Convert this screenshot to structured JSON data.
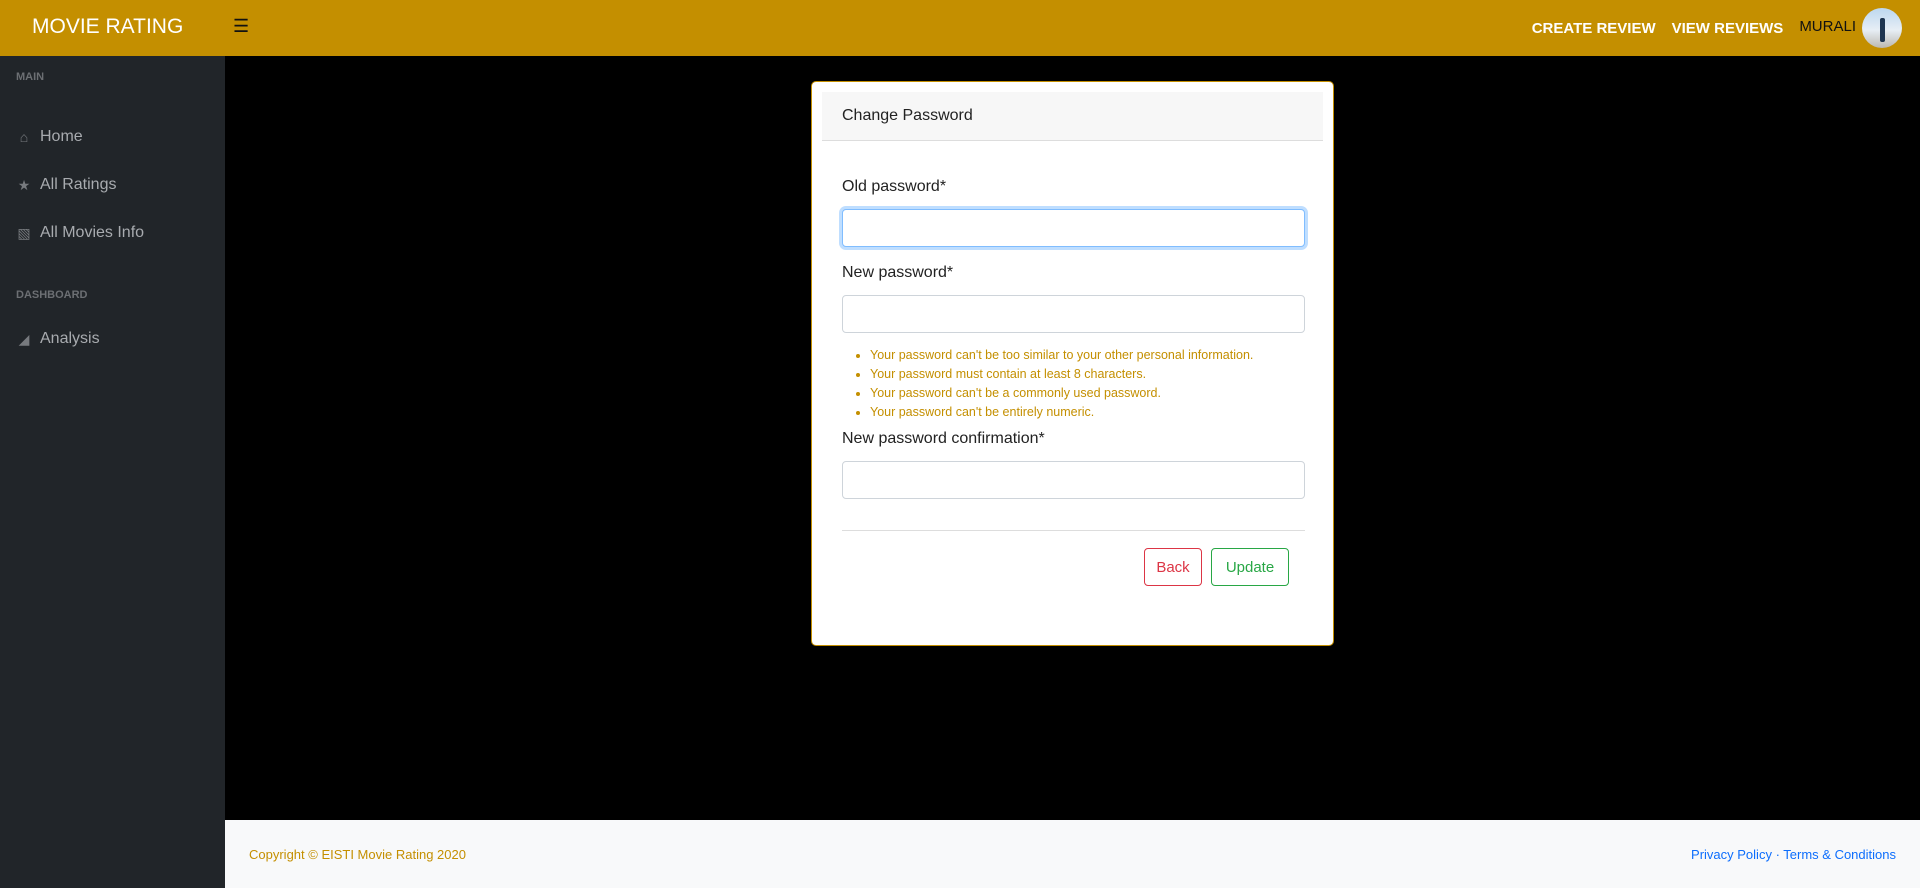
{
  "header": {
    "brand": "MOVIE RATING",
    "menu_icon": "hamburger-icon",
    "nav": [
      "CREATE REVIEW",
      "VIEW REVIEWS"
    ],
    "user": "MURALI"
  },
  "sidebar": {
    "sections": [
      {
        "title": "MAIN",
        "items": [
          {
            "label": "Home",
            "icon": "home-icon"
          },
          {
            "label": "All Ratings",
            "icon": "star-icon"
          },
          {
            "label": "All Movies Info",
            "icon": "film-icon"
          }
        ]
      },
      {
        "title": "DASHBOARD",
        "items": [
          {
            "label": "Analysis",
            "icon": "area-chart-icon"
          }
        ]
      }
    ]
  },
  "form": {
    "title": "Change Password",
    "old_label": "Old password*",
    "old_value": "",
    "new_label": "New password*",
    "new_value": "",
    "hints": [
      "Your password can't be too similar to your other personal information.",
      "Your password must contain at least 8 characters.",
      "Your password can't be a commonly used password.",
      "Your password can't be entirely numeric."
    ],
    "confirm_label": "New password confirmation*",
    "confirm_value": "",
    "back": "Back",
    "update": "Update"
  },
  "footer": {
    "copyright": "Copyright © EISTI Movie Rating 2020",
    "privacy": "Privacy Policy",
    "sep": " · ",
    "terms": "Terms & Conditions"
  },
  "colors": {
    "accent": "#c48f00",
    "sidebar": "#212529",
    "danger": "#dc3545",
    "success": "#28a745"
  }
}
